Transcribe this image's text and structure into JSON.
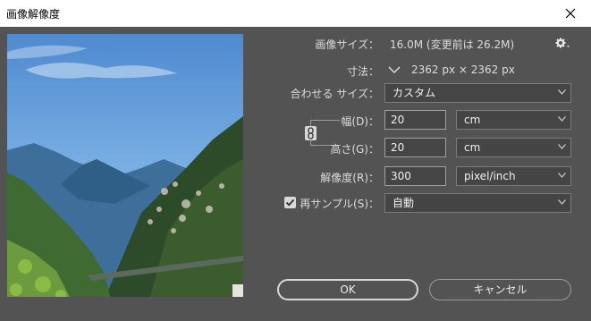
{
  "window": {
    "title": "画像解像度"
  },
  "info": {
    "image_size_label": "画像サイズ：",
    "image_size_value": "16.0M (変更前は 26.2M)",
    "dimensions_label": "寸法：",
    "dimensions_value": "2362 px × 2362 px"
  },
  "fit": {
    "label": "合わせる サイズ：",
    "value": "カスタム"
  },
  "width": {
    "label": "幅(D)：",
    "value": "20",
    "unit": "cm"
  },
  "height": {
    "label": "高さ(G)：",
    "value": "20",
    "unit": "cm"
  },
  "resolution": {
    "label": "解像度(R)：",
    "value": "300",
    "unit": "pixel/inch"
  },
  "resample": {
    "label": "再サンプル(S)：",
    "checked": true,
    "value": "自動"
  },
  "buttons": {
    "ok": "OK",
    "cancel": "キャンセル"
  },
  "colors": {
    "panel": "#535353",
    "field": "#454545",
    "titlebar": "#ffffff"
  }
}
